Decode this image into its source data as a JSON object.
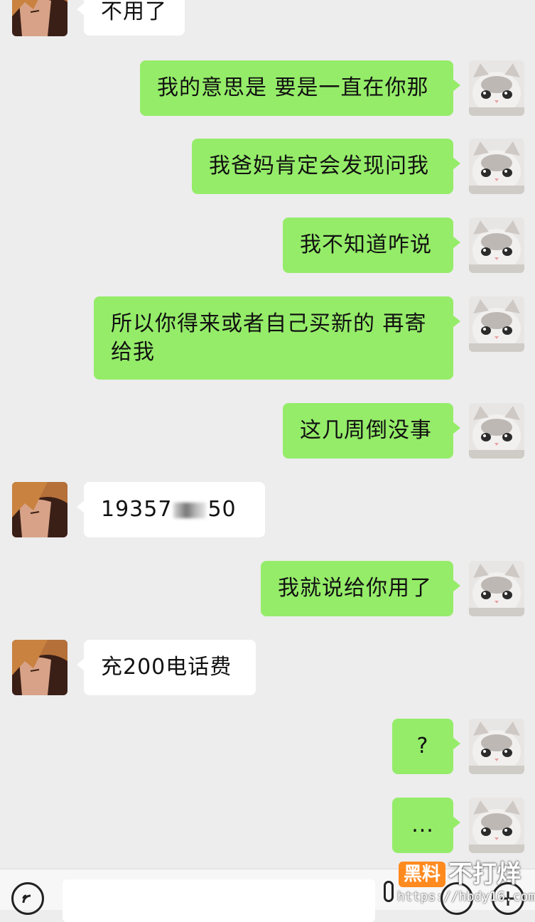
{
  "messages": [
    {
      "from": "other",
      "text": "不用了"
    },
    {
      "from": "me",
      "text": "我的意思是 要是一直在你那"
    },
    {
      "from": "me",
      "text": "我爸妈肯定会发现问我"
    },
    {
      "from": "me",
      "text": "我不知道咋说"
    },
    {
      "from": "me",
      "line1": "所以你得来或者自己买新的 再寄",
      "line2": "给我"
    },
    {
      "from": "me",
      "text": "这几周倒没事"
    },
    {
      "from": "other",
      "text_prefix": "19357",
      "text_suffix": "50"
    },
    {
      "from": "me",
      "text": "我就说给你用了"
    },
    {
      "from": "other",
      "text": "充200电话费"
    },
    {
      "from": "me",
      "text": "?"
    },
    {
      "from": "me",
      "text": "..."
    }
  ],
  "watermark": {
    "badge": "黑料",
    "text": "不打烊",
    "url": "https://hbdy16.com"
  },
  "colors": {
    "my_bubble": "#95ec69",
    "other_bubble": "#ffffff",
    "background": "#ededed"
  }
}
